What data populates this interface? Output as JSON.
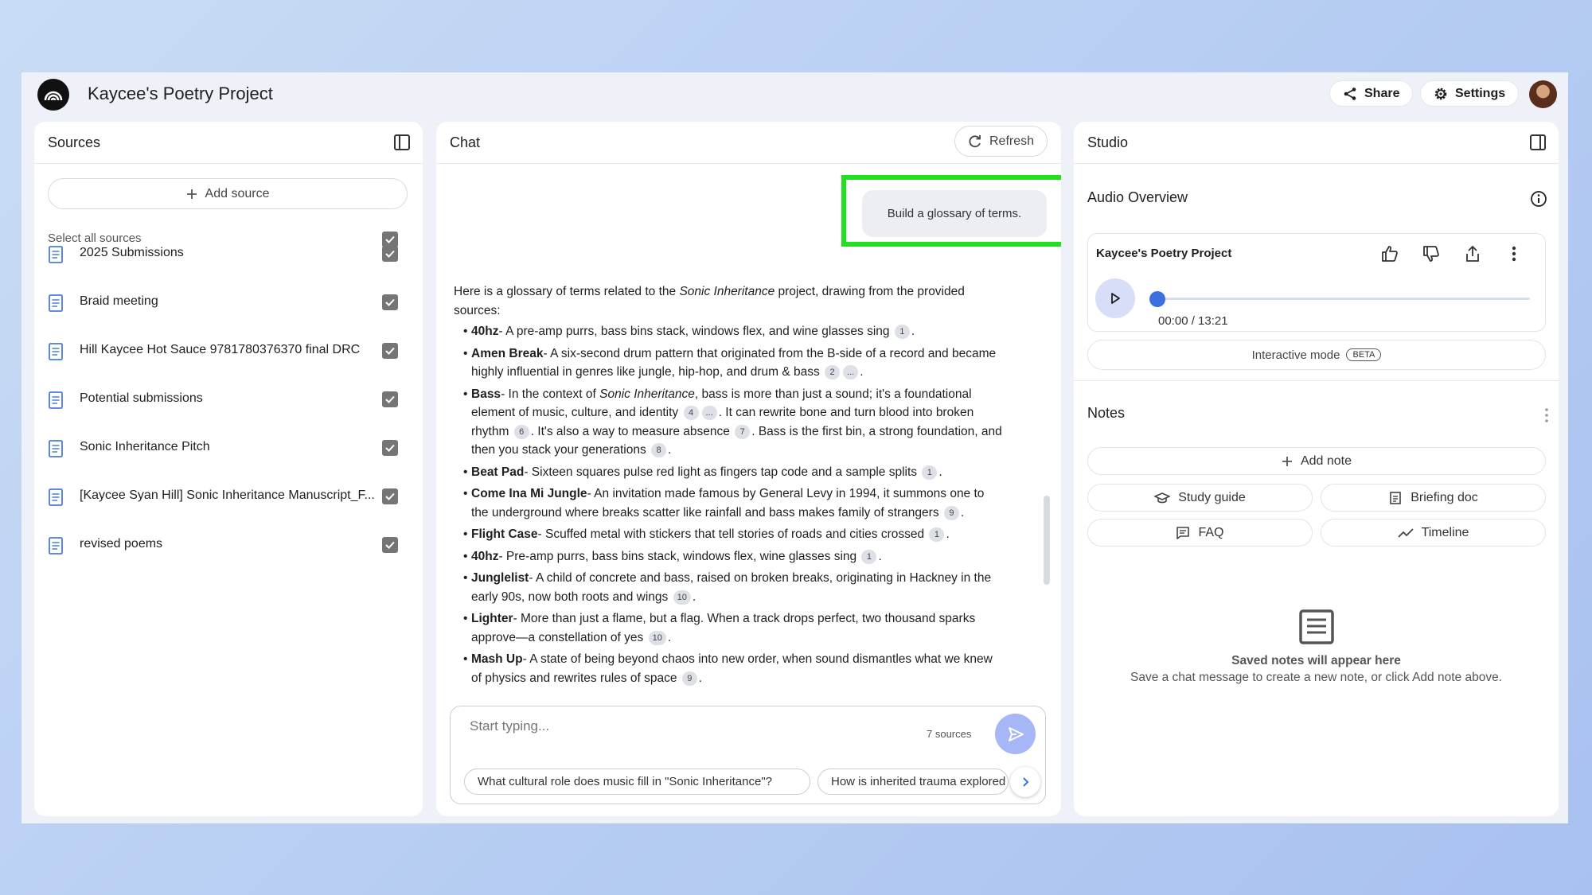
{
  "app": {
    "title": "Kaycee's Poetry Project",
    "share_label": "Share",
    "settings_label": "Settings"
  },
  "sources": {
    "title": "Sources",
    "add_source_label": "Add source",
    "select_all_label": "Select all sources",
    "items": [
      {
        "label": "2025 Submissions"
      },
      {
        "label": "Braid meeting"
      },
      {
        "label": "Hill Kaycee Hot Sauce 9781780376370 final DRC"
      },
      {
        "label": "Potential submissions"
      },
      {
        "label": "Sonic Inheritance Pitch"
      },
      {
        "label": "[Kaycee Syan Hill] Sonic Inheritance Manuscript_F..."
      },
      {
        "label": "revised poems"
      }
    ]
  },
  "chat": {
    "title": "Chat",
    "refresh_label": "Refresh",
    "user_message": "Build a glossary of terms.",
    "intro_pre": "Here is a glossary of terms related to the ",
    "intro_em": "Sonic Inheritance",
    "intro_post": " project, drawing from the provided sources:",
    "terms": [
      {
        "term": "40hz",
        "def": "- A pre-amp purrs, bass bins stack, windows flex, and wine glasses sing",
        "cites": [
          "1"
        ]
      },
      {
        "term": "Amen Break",
        "def": "- A six-second drum pattern that originated from the B-side of a record and became highly influential in genres like jungle, hip-hop, and drum & bass",
        "cites": [
          "2",
          "..."
        ]
      },
      {
        "term": "Beat Pad",
        "def": "- Sixteen squares pulse red light as fingers tap code and a sample splits",
        "cites": [
          "1"
        ]
      },
      {
        "term": "Come Ina Mi Jungle",
        "def": "- An invitation made famous by General Levy in 1994, it summons one to the underground where breaks scatter like rainfall and bass makes family of strangers",
        "cites": [
          "9"
        ]
      },
      {
        "term": "Flight Case",
        "def": "- Scuffed metal with stickers that tell stories of roads and cities crossed",
        "cites": [
          "1"
        ]
      },
      {
        "term": "40hz",
        "def": "- Pre-amp purrs, bass bins stack, windows flex, wine glasses sing",
        "cites": [
          "1"
        ]
      },
      {
        "term": "Junglelist",
        "def": "- A child of concrete and bass, raised on broken breaks, originating in Hackney in the early 90s, now both roots and wings",
        "cites": [
          "10"
        ]
      },
      {
        "term": "Lighter",
        "def": "- More than just a flame, but a flag. When a track drops perfect, two thousand sparks approve—a constellation of yes",
        "cites": [
          "10"
        ]
      },
      {
        "term": "Mash Up",
        "def": "- A state of being beyond chaos into new order, when sound dismantles what we knew of physics and rewrites rules of space",
        "cites": [
          "9"
        ]
      }
    ],
    "bass": {
      "term": "Bass",
      "t1": "- In the context of ",
      "em": "Sonic Inheritance",
      "t2": ", bass is more than just a sound; it's a foundational element of music, culture, and identity",
      "c1": "4",
      "c2": "...",
      "t3": ". It can rewrite bone and turn blood into broken rhythm",
      "c3": "6",
      "t4": ". It's also a way to measure absence",
      "c4": "7",
      "t5": ". Bass is the first bin, a strong foundation, and then you stack your generations",
      "c5": "8"
    },
    "input_placeholder": "Start typing...",
    "sources_count": "7 sources",
    "suggestions": [
      "What cultural role does music fill in \"Sonic Inheritance\"?",
      "How is inherited trauma explored"
    ]
  },
  "studio": {
    "title": "Studio",
    "audio_overview_label": "Audio Overview",
    "audio_card_title": "Kaycee's Poetry Project",
    "time_display": "00:00 / 13:21",
    "progress": 0,
    "interactive_mode_label": "Interactive mode",
    "beta_label": "BETA",
    "notes_label": "Notes",
    "add_note_label": "Add note",
    "study_guide_label": "Study guide",
    "briefing_doc_label": "Briefing doc",
    "faq_label": "FAQ",
    "timeline_label": "Timeline",
    "empty_title": "Saved notes will appear here",
    "empty_subtitle": "Save a chat message to create a new note, or click Add note above."
  },
  "colors": {
    "accent": "#3c6fe0",
    "highlight": "#20e020",
    "send_button": "#a6b6f6"
  },
  "icons": [
    "logo-icon",
    "share-icon",
    "gear-icon",
    "panel-toggle-icon",
    "plus-icon",
    "checkbox-icon",
    "document-icon",
    "refresh-icon",
    "send-icon",
    "chevron-right-icon",
    "info-icon",
    "thumbs-up-icon",
    "thumbs-down-icon",
    "share-out-icon",
    "more-vert-icon",
    "play-icon",
    "study-guide-icon",
    "briefing-doc-icon",
    "faq-icon",
    "timeline-icon",
    "note-icon"
  ]
}
